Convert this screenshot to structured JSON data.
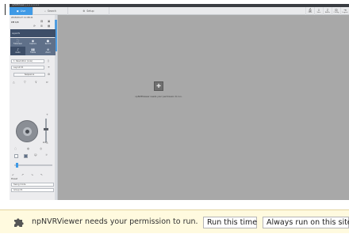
{
  "browser": {
    "tab_strip_text": "npNVRViewer   |   ≡  ≡  ≡  ≡  ≡  ≡"
  },
  "app": {
    "tabs": [
      {
        "label": "Live",
        "icon": "camera-icon",
        "active": true
      },
      {
        "label": "Search",
        "icon": "search-icon",
        "active": false
      },
      {
        "label": "Setup",
        "icon": "gear-icon",
        "active": false
      }
    ],
    "toolbar": [
      {
        "label": "Print",
        "icon": "printer-icon"
      },
      {
        "label": "Save",
        "icon": "download-icon"
      },
      {
        "label": "Alarm",
        "icon": "bell-icon"
      },
      {
        "label": "Config",
        "icon": "user-icon"
      },
      {
        "label": "Logout",
        "icon": "logout-icon"
      }
    ]
  },
  "panel": {
    "datetime": "2018-09-27  11:08:41",
    "channel": "CH 1/4",
    "layout_label": "Layout N",
    "tiles": [
      {
        "label": "Fullscreen",
        "icon": "fullscreen-icon"
      },
      {
        "label": "Capture",
        "icon": "camera-icon"
      },
      {
        "label": "Record",
        "icon": "record-icon"
      },
      {
        "label": "Audio",
        "icon": "speaker-icon"
      },
      {
        "label": "Freeze",
        "icon": "pause-icon"
      },
      {
        "label": "Zoom",
        "icon": "zoom-icon"
      }
    ],
    "profile_select": "1. Resolution (Low)",
    "layout_select": "Layout 01",
    "sequence_button": "Sequence",
    "zoom_label": "Zoom",
    "preset_label": "Preset",
    "preset_select": "Preset 01",
    "swing_label": "Swing",
    "swing_select": "Swing mode",
    "group_select": "Group 01"
  },
  "plugin": {
    "message": "npNVRViewer needs your permission to run."
  },
  "infobar": {
    "text": "npNVRViewer needs your permission to run.",
    "run_once": "Run this time",
    "run_always": "Always run on this site",
    "icon": "puzzle-piece-icon"
  }
}
